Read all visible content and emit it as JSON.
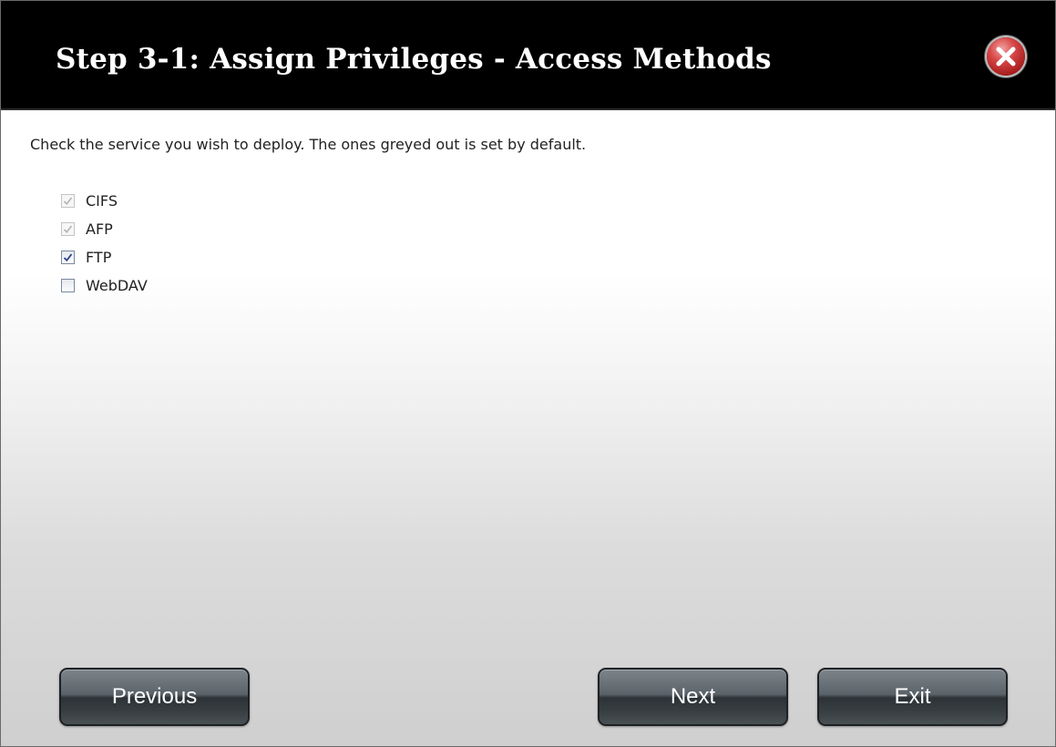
{
  "dialog": {
    "title": "Step 3-1: Assign Privileges - Access Methods",
    "instruction": "Check the service you wish to deploy. The ones greyed out is set by default.",
    "services": [
      {
        "label": "CIFS",
        "checked": true,
        "disabled": true
      },
      {
        "label": "AFP",
        "checked": true,
        "disabled": true
      },
      {
        "label": "FTP",
        "checked": true,
        "disabled": false
      },
      {
        "label": "WebDAV",
        "checked": false,
        "disabled": false
      }
    ],
    "buttons": {
      "previous": "Previous",
      "next": "Next",
      "exit": "Exit"
    }
  },
  "colors": {
    "titlebar": "#000000",
    "close": "#d84848",
    "button": "#4a5155"
  },
  "icons": {
    "close": "close-icon",
    "check": "check-icon"
  }
}
